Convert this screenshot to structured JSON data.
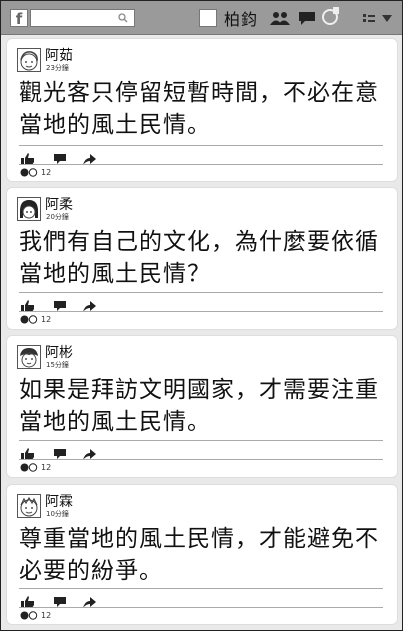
{
  "topbar": {
    "logo": "f",
    "username": "柏鈞",
    "icons": [
      "friends-icon",
      "messages-icon",
      "notifications-icon",
      "settings-icon"
    ]
  },
  "posts": [
    {
      "name": "阿茹",
      "time": "23分鐘",
      "text": "觀光客只停留短暫時間，不必在意當地的風土民情。",
      "count": "12"
    },
    {
      "name": "阿柔",
      "time": "20分鐘",
      "text": "我們有自己的文化，為什麼要依循當地的風土民情？",
      "count": "12"
    },
    {
      "name": "阿彬",
      "time": "15分鐘",
      "text": "如果是拜訪文明國家，才需要注重當地的風土民情。",
      "count": "12"
    },
    {
      "name": "阿霖",
      "time": "10分鐘",
      "text": "尊重當地的風土民情，才能避免不必要的紛爭。",
      "count": "12"
    }
  ]
}
